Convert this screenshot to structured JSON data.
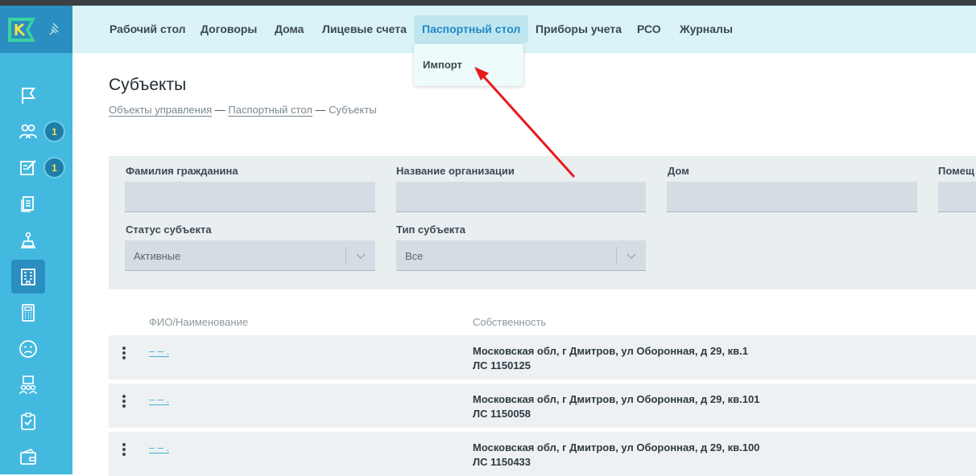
{
  "nav": {
    "items": [
      "Рабочий стол",
      "Договоры",
      "Дома",
      "Лицевые счета",
      "Паспортный стол",
      "Приборы учета",
      "РСО",
      "Журналы"
    ],
    "active": "Паспортный стол",
    "dropdown_item": "Импорт"
  },
  "sidebar": {
    "badges": [
      "1",
      "1"
    ],
    "icons": [
      "flag-icon",
      "people-icon",
      "edit-icon",
      "documents-icon",
      "meter-icon",
      "building-icon",
      "calculator-icon",
      "sad-face-icon",
      "group-icon",
      "checklist-icon",
      "wallet-icon"
    ]
  },
  "page": {
    "title": "Субъекты",
    "breadcrumb": [
      "Объекты управления",
      "Паспортный стол",
      "Субъекты"
    ]
  },
  "filters": {
    "surname_label": "Фамилия гражданина",
    "org_label": "Название организации",
    "house_label": "Дом",
    "room_label": "Помещ",
    "status_label": "Статус субъекта",
    "status_value": "Активные",
    "type_label": "Тип субъекта",
    "type_value": "Все"
  },
  "table": {
    "headers": [
      "ФИО/Наименование",
      "Собственность"
    ],
    "rows": [
      {
        "name": "– – .",
        "address": "Московская обл, г Дмитров, ул Оборонная, д 29, кв.1",
        "account": "ЛС 1150125"
      },
      {
        "name": "– – .",
        "address": "Московская обл, г Дмитров, ул Оборонная, д 29, кв.101",
        "account": "ЛС 1150058"
      },
      {
        "name": "– – .",
        "address": "Московская обл, г Дмитров, ул Оборонная, д 29, кв.100",
        "account": "ЛС 1150433"
      }
    ]
  },
  "colors": {
    "sidebar": "#43b9e0",
    "accent": "#1e88c9",
    "arrow": "#e8191b"
  }
}
